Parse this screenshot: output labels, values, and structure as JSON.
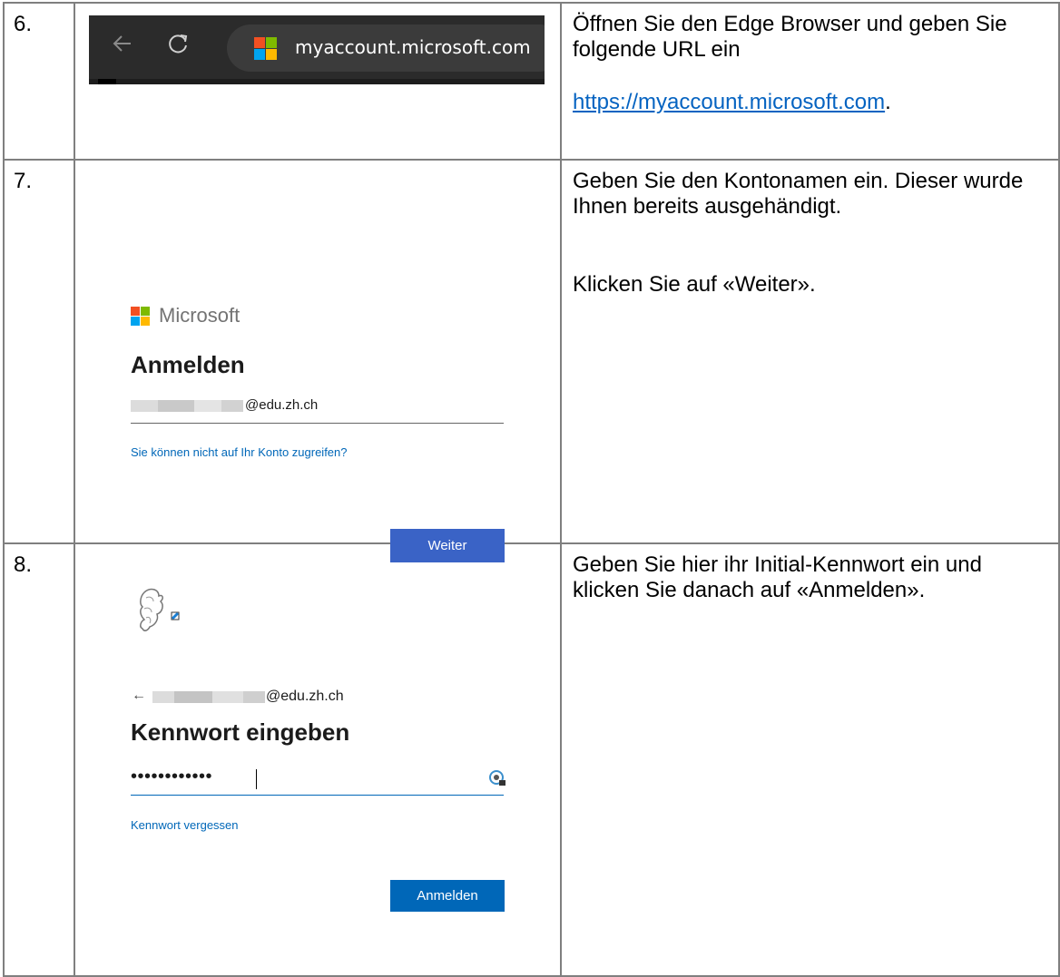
{
  "steps": [
    {
      "number": "6.",
      "browser": {
        "url": "myaccount.microsoft.com"
      },
      "instruction_lines": [
        "Öffnen Sie den Edge Browser und geben Sie folgende URL ein"
      ],
      "link": "https://myaccount.microsoft.com",
      "link_suffix": "."
    },
    {
      "number": "7.",
      "signin": {
        "brand": "Microsoft",
        "title": "Anmelden",
        "email_suffix": "@edu.zh.ch",
        "help_link": "Sie können nicht auf Ihr Konto zugreifen?",
        "button": "Weiter"
      },
      "instruction_1": "Geben Sie den Kontonamen ein. Dieser wurde Ihnen bereits ausgehändigt.",
      "instruction_2": "Klicken Sie auf «Weiter»."
    },
    {
      "number": "8.",
      "password": {
        "email_suffix": "@edu.zh.ch",
        "title": "Kennwort eingeben",
        "masked": "••••••••••••",
        "forgot_link": "Kennwort vergessen",
        "button": "Anmelden"
      },
      "instruction": "Geben Sie hier ihr Initial-Kennwort ein und klicken Sie danach auf «Anmelden»."
    }
  ],
  "colors": {
    "ms_red": "#f25022",
    "ms_green": "#7fba00",
    "ms_blue": "#00a4ef",
    "ms_yellow": "#ffb900",
    "button_weiter": "#3a63c6",
    "button_anmelden": "#0067b8",
    "link": "#0563c1"
  },
  "icons": [
    "back-arrow-icon",
    "refresh-icon",
    "microsoft-logo-icon",
    "zurich-crest-icon",
    "password-reveal-icon"
  ]
}
